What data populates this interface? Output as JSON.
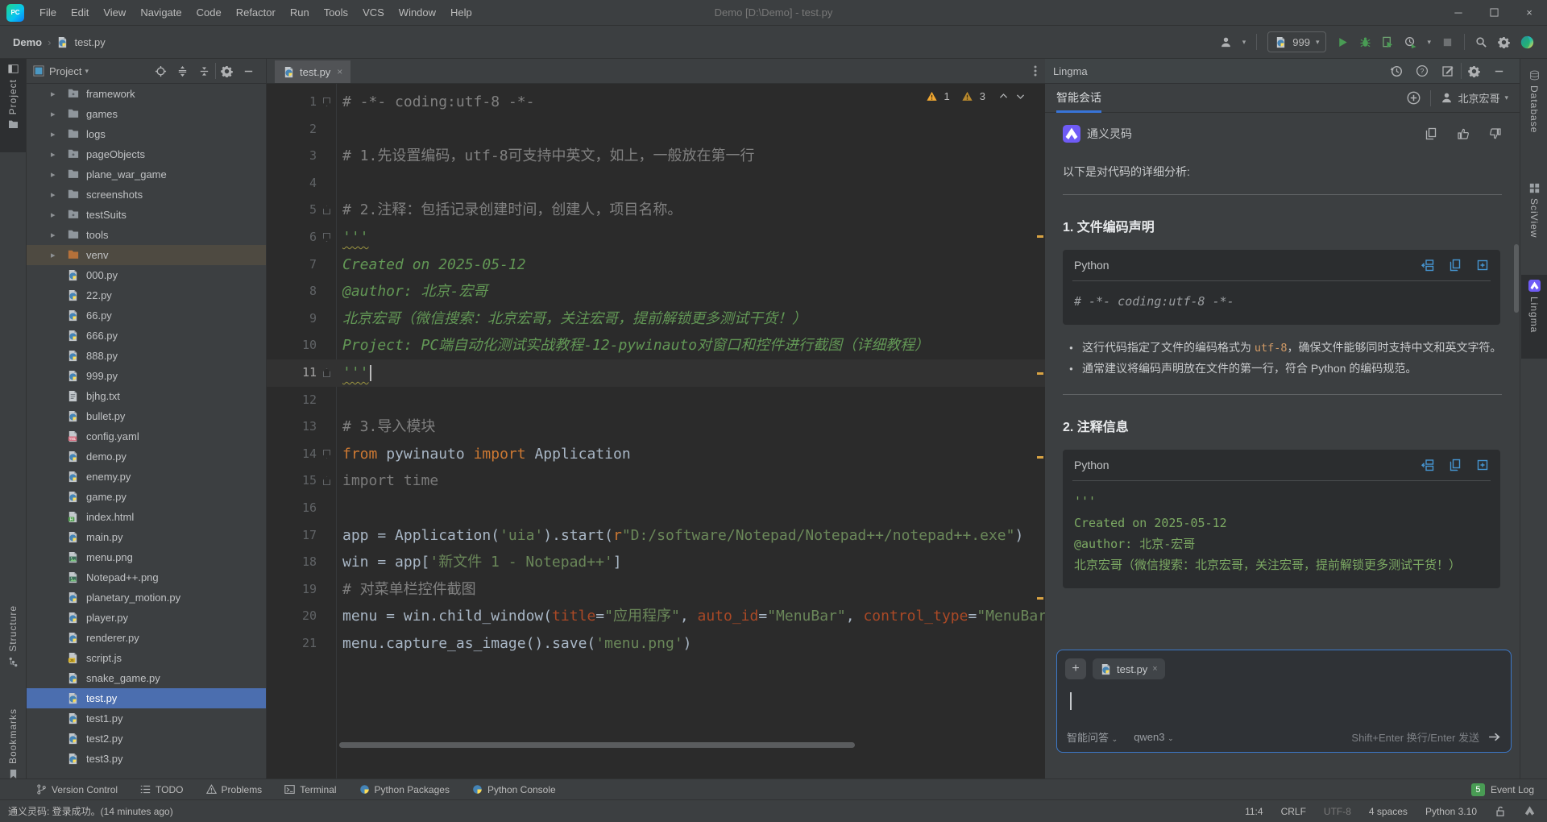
{
  "window": {
    "title": "Demo [D:\\Demo] - test.py",
    "menus": [
      "File",
      "Edit",
      "View",
      "Navigate",
      "Code",
      "Refactor",
      "Run",
      "Tools",
      "VCS",
      "Window",
      "Help"
    ],
    "logo_text": "PC"
  },
  "navbar": {
    "breadcrumb_root": "Demo",
    "breadcrumb_sep": "›",
    "breadcrumb_file": "test.py",
    "run_config": "999"
  },
  "left_stripe": {
    "project": "Project",
    "structure": "Structure",
    "bookmarks": "Bookmarks"
  },
  "right_stripe": {
    "database": "Database",
    "sciview": "SciView",
    "lingma": "Lingma"
  },
  "project_panel": {
    "title": "Project",
    "tree": [
      {
        "label": "framework",
        "kind": "package"
      },
      {
        "label": "games",
        "kind": "folder"
      },
      {
        "label": "logs",
        "kind": "folder"
      },
      {
        "label": "pageObjects",
        "kind": "package"
      },
      {
        "label": "plane_war_game",
        "kind": "folder"
      },
      {
        "label": "screenshots",
        "kind": "folder"
      },
      {
        "label": "testSuits",
        "kind": "package"
      },
      {
        "label": "tools",
        "kind": "folder"
      },
      {
        "label": "venv",
        "kind": "folder-excluded",
        "hover": true
      },
      {
        "label": "000.py",
        "kind": "python"
      },
      {
        "label": "22.py",
        "kind": "python"
      },
      {
        "label": "66.py",
        "kind": "python"
      },
      {
        "label": "666.py",
        "kind": "python"
      },
      {
        "label": "888.py",
        "kind": "python"
      },
      {
        "label": "999.py",
        "kind": "python"
      },
      {
        "label": "bjhg.txt",
        "kind": "text"
      },
      {
        "label": "bullet.py",
        "kind": "python"
      },
      {
        "label": "config.yaml",
        "kind": "yaml"
      },
      {
        "label": "demo.py",
        "kind": "python"
      },
      {
        "label": "enemy.py",
        "kind": "python"
      },
      {
        "label": "game.py",
        "kind": "python"
      },
      {
        "label": "index.html",
        "kind": "html"
      },
      {
        "label": "main.py",
        "kind": "python"
      },
      {
        "label": "menu.png",
        "kind": "image"
      },
      {
        "label": "Notepad++.png",
        "kind": "image"
      },
      {
        "label": "planetary_motion.py",
        "kind": "python"
      },
      {
        "label": "player.py",
        "kind": "python"
      },
      {
        "label": "renderer.py",
        "kind": "python"
      },
      {
        "label": "script.js",
        "kind": "js"
      },
      {
        "label": "snake_game.py",
        "kind": "python"
      },
      {
        "label": "test.py",
        "kind": "python",
        "selected": true
      },
      {
        "label": "test1.py",
        "kind": "python"
      },
      {
        "label": "test2.py",
        "kind": "python"
      },
      {
        "label": "test3.py",
        "kind": "python"
      }
    ]
  },
  "editor": {
    "tab": "test.py",
    "warning_counts": [
      "1",
      "3"
    ],
    "lines": [
      {
        "n": "1",
        "fold": "dn",
        "seg": [
          {
            "c": "comment",
            "t": "# -*- coding:utf-8 -*-"
          }
        ]
      },
      {
        "n": "2",
        "seg": []
      },
      {
        "n": "3",
        "seg": [
          {
            "c": "comment",
            "t": "# 1.先设置编码，utf-8可支持中英文，如上，一般放在第一行"
          }
        ]
      },
      {
        "n": "4",
        "seg": []
      },
      {
        "n": "5",
        "fold": "up",
        "seg": [
          {
            "c": "comment",
            "t": "# 2.注释：包括记录创建时间，创建人，项目名称。"
          }
        ]
      },
      {
        "n": "6",
        "fold": "dn",
        "seg": [
          {
            "c": "docstring",
            "w": true,
            "t": "'''"
          }
        ]
      },
      {
        "n": "7",
        "seg": [
          {
            "c": "docstring",
            "t": "Created on 2025-05-12"
          }
        ]
      },
      {
        "n": "8",
        "seg": [
          {
            "c": "docstring",
            "t": "@author: 北京-宏哥"
          }
        ]
      },
      {
        "n": "9",
        "seg": [
          {
            "c": "docstring",
            "t": "北京宏哥（微信搜索：北京宏哥，关注宏哥，提前解锁更多测试干货！）"
          }
        ]
      },
      {
        "n": "10",
        "seg": [
          {
            "c": "docstring",
            "t": "Project: PC端自动化测试实战教程-12-pywinauto对窗口和控件进行截图（详细教程）"
          }
        ]
      },
      {
        "n": "11",
        "current": true,
        "caret": true,
        "fold": "up",
        "seg": [
          {
            "c": "docstring",
            "w": true,
            "t": "'''"
          }
        ]
      },
      {
        "n": "12",
        "seg": []
      },
      {
        "n": "13",
        "seg": [
          {
            "c": "comment",
            "t": "# 3.导入模块"
          }
        ]
      },
      {
        "n": "14",
        "fold": "dn",
        "seg": [
          {
            "c": "keyword",
            "t": "from"
          },
          {
            "c": "plain",
            "t": " pywinauto "
          },
          {
            "c": "keyword",
            "t": "import"
          },
          {
            "c": "plain",
            "t": " Application"
          }
        ]
      },
      {
        "n": "15",
        "fold": "up",
        "seg": [
          {
            "c": "grayed",
            "t": "import time"
          }
        ]
      },
      {
        "n": "16",
        "seg": []
      },
      {
        "n": "17",
        "seg": [
          {
            "c": "plain",
            "t": "app = Application("
          },
          {
            "c": "string",
            "t": "'uia'"
          },
          {
            "c": "plain",
            "t": ").start("
          },
          {
            "c": "keyword",
            "t": "r"
          },
          {
            "c": "string",
            "t": "\"D:/software/Notepad/Notepad++/notepad++.exe\""
          },
          {
            "c": "plain",
            "t": ")"
          }
        ]
      },
      {
        "n": "18",
        "seg": [
          {
            "c": "plain",
            "t": "win = app["
          },
          {
            "c": "string",
            "t": "'新文件 1 - Notepad++'"
          },
          {
            "c": "plain",
            "t": "]"
          }
        ]
      },
      {
        "n": "19",
        "seg": [
          {
            "c": "comment",
            "t": "# 对菜单栏控件截图"
          }
        ]
      },
      {
        "n": "20",
        "seg": [
          {
            "c": "plain",
            "t": "menu = win.child_window("
          },
          {
            "c": "param",
            "t": "title"
          },
          {
            "c": "plain",
            "t": "="
          },
          {
            "c": "string",
            "t": "\"应用程序\""
          },
          {
            "c": "plain",
            "t": ", "
          },
          {
            "c": "param",
            "t": "auto_id"
          },
          {
            "c": "plain",
            "t": "="
          },
          {
            "c": "string",
            "t": "\"MenuBar\""
          },
          {
            "c": "plain",
            "t": ", "
          },
          {
            "c": "param",
            "t": "control_type"
          },
          {
            "c": "plain",
            "t": "="
          },
          {
            "c": "string",
            "t": "\"MenuBar\""
          },
          {
            "c": "plain",
            "t": ")"
          }
        ]
      },
      {
        "n": "21",
        "seg": [
          {
            "c": "plain",
            "t": "menu.capture_as_image().save("
          },
          {
            "c": "string",
            "t": "'menu.png'"
          },
          {
            "c": "plain",
            "t": ")"
          }
        ]
      }
    ]
  },
  "lingma": {
    "panel_title": "Lingma",
    "tab": "智能会话",
    "account": "北京宏哥",
    "assistant": "通义灵码",
    "intro": "以下是对代码的详细分析:",
    "sections": [
      {
        "heading": "1. 文件编码声明",
        "lang": "Python",
        "code_style": "cb-comment",
        "code": [
          "# -*- coding:utf-8 -*-"
        ],
        "bullets": [
          [
            {
              "t": "这行代码指定了文件的编码格式为 "
            },
            {
              "t": "utf-8",
              "code": true
            },
            {
              "t": "，确保文件能够同时支持中文和英文字符。"
            }
          ],
          [
            {
              "t": "通常建议将编码声明放在文件的第一行，符合 Python 的编码规范。"
            }
          ]
        ]
      },
      {
        "heading": "2. 注释信息",
        "lang": "Python",
        "code_style": "cb-green",
        "code": [
          "'''",
          "Created on 2025-05-12",
          "@author: 北京-宏哥",
          "北京宏哥（微信搜索：北京宏哥，关注宏哥，提前解锁更多测试干货！）"
        ],
        "bullets": []
      }
    ],
    "input": {
      "attached_file": "test.py",
      "mode": "智能问答",
      "model": "qwen3",
      "send_hint": "Shift+Enter 换行/Enter 发送"
    }
  },
  "bottom_bar": {
    "items": [
      "Version Control",
      "TODO",
      "Problems",
      "Terminal",
      "Python Packages",
      "Python Console"
    ],
    "event_count": "5",
    "event_label": "Event Log"
  },
  "status_bar": {
    "message": "通义灵码: 登录成功。(14 minutes ago)",
    "items": [
      "11:4",
      "CRLF",
      "UTF-8",
      "4 spaces",
      "Python 3.10"
    ]
  },
  "colors": {
    "selection_blue": "#4b6eaf",
    "tab_underline_blue": "#3874d8",
    "run_green": "#499c54",
    "warning_yellow": "#f0a732",
    "warning_dim": "#b8892e",
    "lingma_purple": "#6f5bf6",
    "codeblock_icon_blue": "#4696d2"
  }
}
